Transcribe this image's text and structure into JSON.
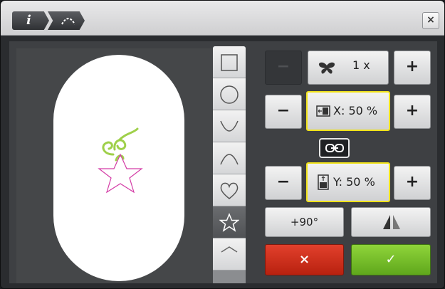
{
  "titlebar": {
    "crumbs": [
      {
        "icon": "info-icon",
        "label": "i"
      },
      {
        "icon": "arc-path-icon"
      }
    ],
    "close_label": "×"
  },
  "shapes": {
    "items": [
      {
        "icon": "square-icon"
      },
      {
        "icon": "circle-icon"
      },
      {
        "icon": "arc-down-icon"
      },
      {
        "icon": "arc-up-icon"
      },
      {
        "icon": "heart-icon"
      },
      {
        "icon": "star-icon",
        "selected": true
      },
      {
        "icon": "chevron-up-icon"
      }
    ]
  },
  "repeat": {
    "minus": "−",
    "value": "1 x",
    "plus": "+",
    "icon": "butterfly-icon"
  },
  "scale_x": {
    "minus": "−",
    "value": "X: 50 %",
    "plus": "+",
    "icon": "width-scale-icon"
  },
  "scale_y": {
    "minus": "−",
    "value": "Y: 50 %",
    "plus": "+",
    "icon": "height-scale-icon"
  },
  "link": {
    "icon": "link-icon"
  },
  "rotate": {
    "label": "+90°"
  },
  "mirror": {
    "icon": "mirror-icon"
  },
  "actions": {
    "cancel": "×",
    "confirm": "✓"
  },
  "colors": {
    "field_highlight": "#f0e21a",
    "cancel": "#c9301c",
    "confirm": "#74be2a",
    "star_stroke": "#d43ca6",
    "swirl": "#9fd04a"
  }
}
